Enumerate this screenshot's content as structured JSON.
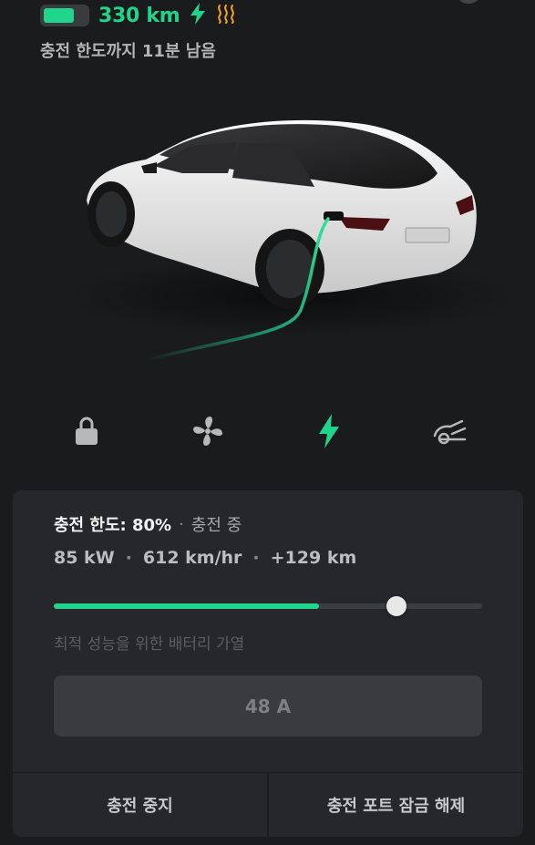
{
  "status": {
    "range": "330 km",
    "battery_level": 0.72,
    "charging_icon": "bolt-icon",
    "heating_icon": "battery-heat-icon"
  },
  "subtitle": "충전 한도까지 11분 남음",
  "quick_controls": [
    {
      "name": "lock",
      "icon": "lock-icon",
      "active": false
    },
    {
      "name": "climate",
      "icon": "fan-icon",
      "active": false
    },
    {
      "name": "charge",
      "icon": "bolt-icon",
      "active": true
    },
    {
      "name": "autopilot",
      "icon": "car-control-icon",
      "active": false
    }
  ],
  "charging": {
    "limit_label": "충전 한도: 80%",
    "state": "충전 중",
    "power": "85 kW",
    "rate": "612 km/hr",
    "added": "+129 km",
    "current_fraction": 0.62,
    "limit_fraction": 0.8,
    "note": "최적 성능을 위한 배터리 가열",
    "amps": "48 A"
  },
  "actions": {
    "stop": "충전 중지",
    "unlock_port": "충전 포트 잠금 해제"
  },
  "colors": {
    "accent": "#1fd48b",
    "heat": "#f5a623",
    "background": "#1a1b1d",
    "panel": "#26272a"
  }
}
